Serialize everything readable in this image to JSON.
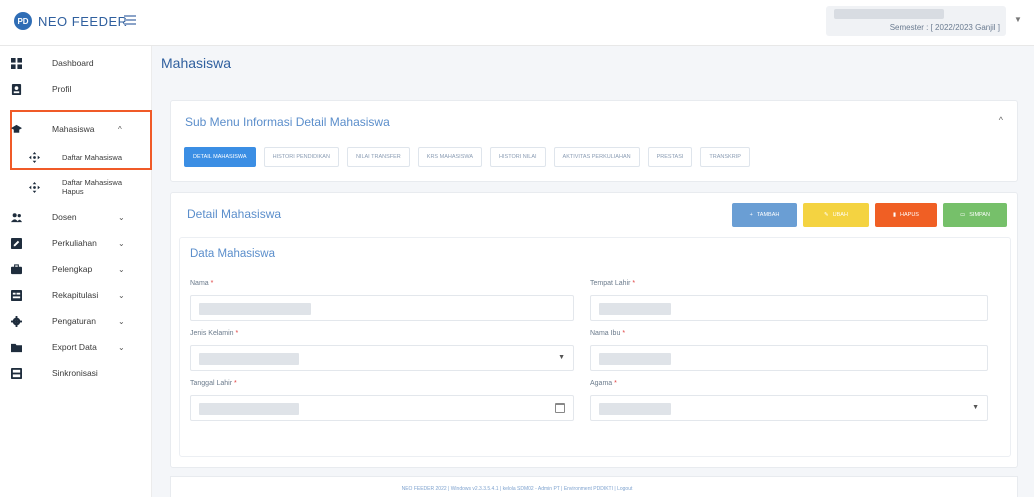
{
  "app": {
    "brand": "NEO FEEDER",
    "logo_text": "PD",
    "semester": "Semester : [ 2022/2023 Ganjil ]"
  },
  "sidebar": {
    "items": [
      {
        "label": "Dashboard",
        "icon": "dashboard-icon",
        "has_caret": false
      },
      {
        "label": "Profil",
        "icon": "profile-icon",
        "has_caret": false
      },
      {
        "label": "Mahasiswa",
        "icon": "graduation-cap-icon",
        "has_caret": true,
        "caret": "^"
      },
      {
        "label": "Daftar Mahasiswa",
        "icon": "move-icon",
        "submenu": true
      },
      {
        "label": "Daftar Mahasiswa Hapus",
        "icon": "move-icon",
        "submenu": true
      },
      {
        "label": "Dosen",
        "icon": "users-icon",
        "has_caret": true,
        "caret": "⌄"
      },
      {
        "label": "Perkuliahan",
        "icon": "edit-icon",
        "has_caret": true,
        "caret": "⌄"
      },
      {
        "label": "Pelengkap",
        "icon": "briefcase-icon",
        "has_caret": true,
        "caret": "⌄"
      },
      {
        "label": "Rekapitulasi",
        "icon": "report-icon",
        "has_caret": true,
        "caret": "⌄"
      },
      {
        "label": "Pengaturan",
        "icon": "gear-icon",
        "has_caret": true,
        "caret": "⌄"
      },
      {
        "label": "Export Data",
        "icon": "folder-icon",
        "has_caret": true,
        "caret": "⌄"
      },
      {
        "label": "Sinkronisasi",
        "icon": "sync-icon",
        "has_caret": false
      }
    ]
  },
  "main": {
    "title": "Mahasiswa",
    "submenu_title": "Sub Menu Informasi Detail Mahasiswa",
    "tabs": [
      "DETAIL MAHASISWA",
      "HISTORI PENDIDIKAN",
      "NILAI TRANSFER",
      "KRS MAHASISWA",
      "HISTORI NILAI",
      "AKTIVITAS PERKULIAHAN",
      "PRESTASI",
      "TRANSKRIP"
    ],
    "detail_title": "Detail Mahasiswa",
    "actions": {
      "add": "TAMBAH",
      "edit": "UBAH",
      "delete": "HAPUS",
      "save": "SIMPAN"
    },
    "form": {
      "section_title": "Data Mahasiswa",
      "nama_label": "Nama",
      "tempat_lahir_label": "Tempat Lahir",
      "jenis_kelamin_label": "Jenis Kelamin",
      "nama_ibu_label": "Nama Ibu",
      "tanggal_lahir_label": "Tanggal Lahir",
      "agama_label": "Agama",
      "required_mark": "*"
    }
  },
  "footer": {
    "text": "NEO FEEDER 2022 | Windows v2.3.3.5.4.1 | kelola SDM02 - Admin PT | Environment PDDIKTI | Logout"
  },
  "colors": {
    "accent": "#2f5f9e",
    "highlight_border": "#f05a28",
    "tab_active": "#3b8ee4"
  }
}
